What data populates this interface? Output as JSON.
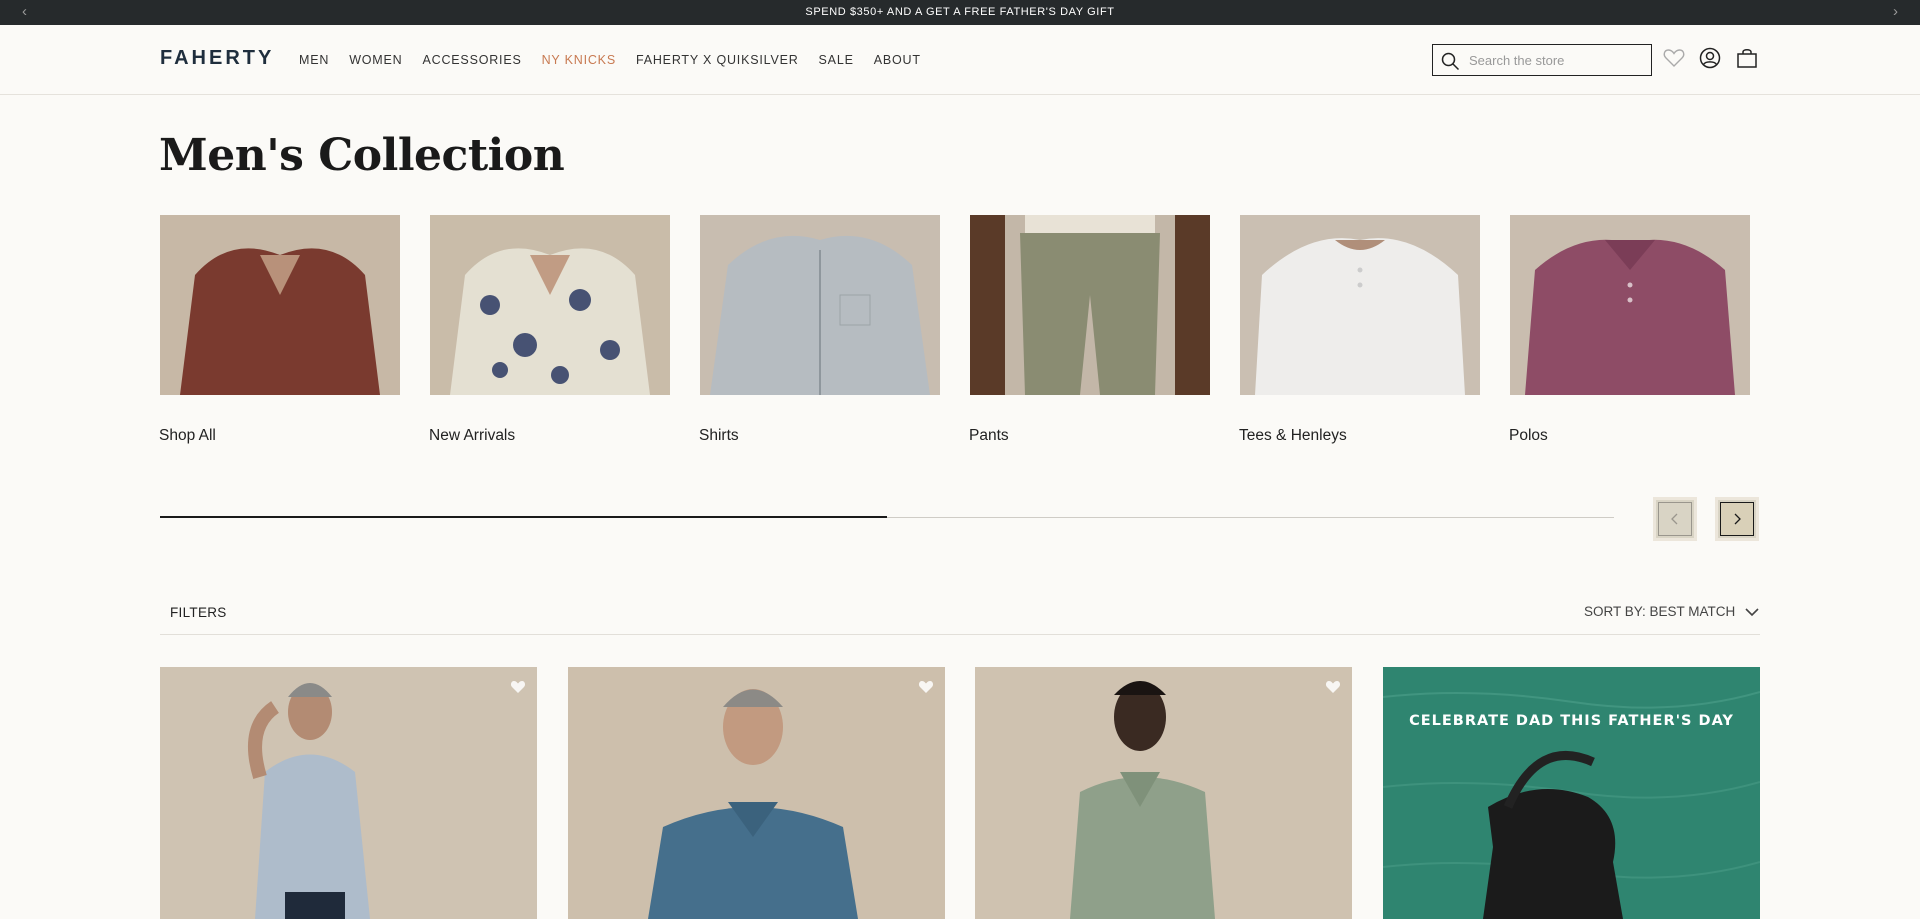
{
  "promo_bar": {
    "message": "SPEND $350+ AND A GET A FREE FATHER'S DAY GIFT",
    "prev_icon": "chevron-left-icon",
    "next_icon": "chevron-right-icon"
  },
  "header": {
    "logo": "FAHERTY",
    "nav": [
      {
        "label": "MEN"
      },
      {
        "label": "WOMEN"
      },
      {
        "label": "ACCESSORIES"
      },
      {
        "label": "NY KNICKS",
        "accent": "#c87a52"
      },
      {
        "label": "FAHERTY X QUIKSILVER"
      },
      {
        "label": "SALE"
      },
      {
        "label": "ABOUT"
      }
    ],
    "search": {
      "placeholder": "Search the store",
      "value": "",
      "icon": "search-icon"
    },
    "icons": [
      "heart-icon",
      "account-icon",
      "bag-icon"
    ]
  },
  "page": {
    "title": "Men's Collection"
  },
  "categories": [
    {
      "label": "Shop All",
      "shirt_color": "#7a3a2f"
    },
    {
      "label": "New Arrivals",
      "shirt_color": "#e4e0d2"
    },
    {
      "label": "Shirts",
      "shirt_color": "#b6bcc1"
    },
    {
      "label": "Pants",
      "shirt_color": "#8a8c72"
    },
    {
      "label": "Tees & Henleys",
      "shirt_color": "#eeedeb"
    },
    {
      "label": "Polos",
      "shirt_color": "#8e4c66"
    }
  ],
  "carousel": {
    "progress": 0.5,
    "prev_icon": "chevron-left-icon",
    "next_icon": "chevron-right-icon"
  },
  "filter_bar": {
    "filters_label": "FILTERS",
    "sort_label": "SORT BY: BEST MATCH",
    "sort_icon": "chevron-down-icon"
  },
  "products": [
    {
      "shirt_color": "#aebccb",
      "icon": "heart-icon"
    },
    {
      "shirt_color": "#456f8c",
      "icon": "heart-icon"
    },
    {
      "shirt_color": "#8fa08a",
      "icon": "heart-icon"
    }
  ],
  "promo_tile": {
    "heading": "CELEBRATE DAD THIS FATHER'S DAY",
    "background": "#2f8570"
  },
  "colors": {
    "accent": "#c87a52",
    "background": "#fbfaf7",
    "promo_bar": "#262a2c"
  }
}
